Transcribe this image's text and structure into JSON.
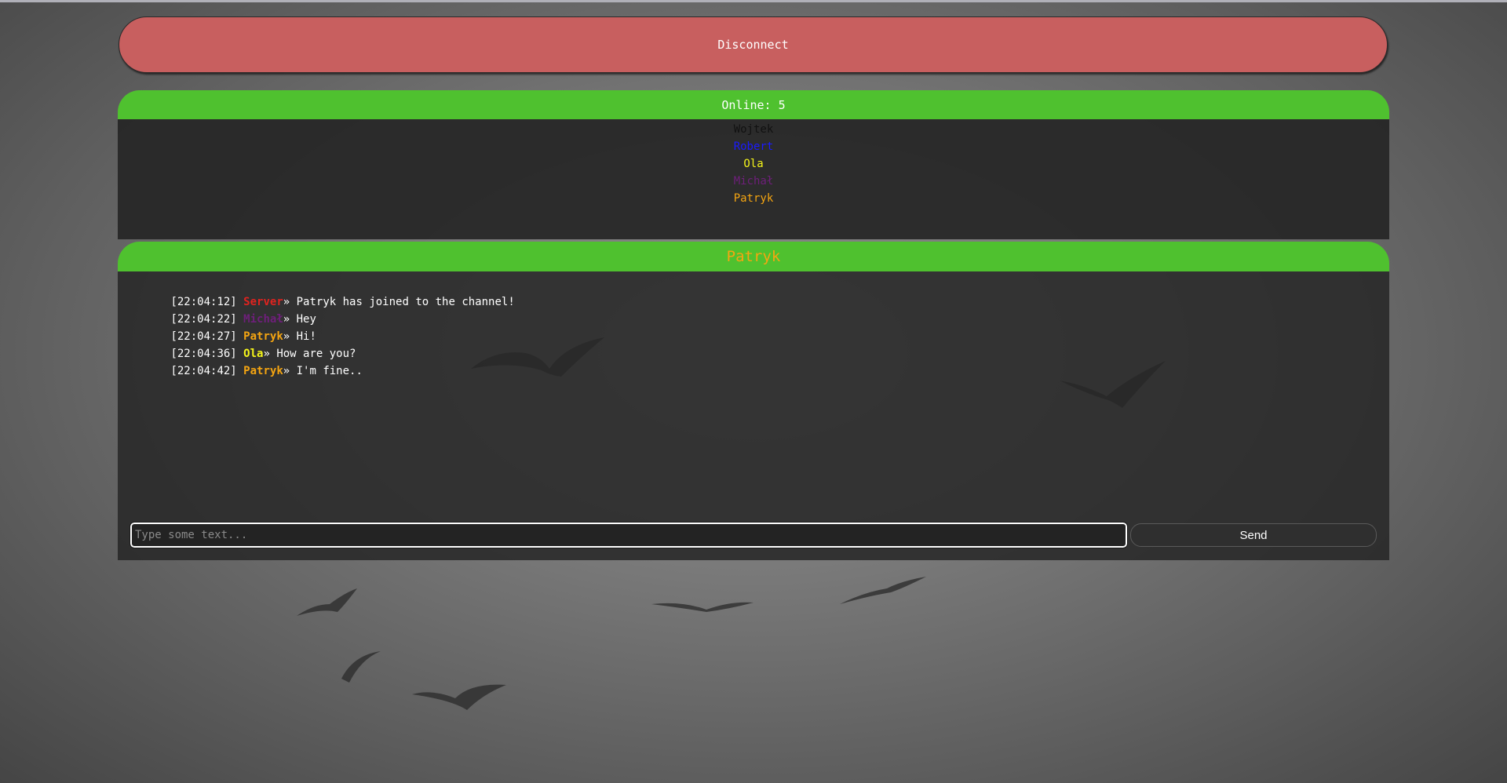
{
  "disconnect_label": "Disconnect",
  "online": {
    "label": "Online: 5",
    "users": [
      {
        "name": "Wojtek",
        "color": "#111111"
      },
      {
        "name": "Robert",
        "color": "#1a1aff"
      },
      {
        "name": "Ola",
        "color": "#f5f51a"
      },
      {
        "name": "Michał",
        "color": "#6e1f7a"
      },
      {
        "name": "Patryk",
        "color": "#f5a511"
      }
    ]
  },
  "chat": {
    "current_user": "Patryk",
    "messages": [
      {
        "time": "[22:04:12]",
        "author": "Server",
        "author_color": "#e0231f",
        "text": "Patryk has joined to the channel!"
      },
      {
        "time": "[22:04:22]",
        "author": "Michał",
        "author_color": "#6e1f7a",
        "text": "Hey"
      },
      {
        "time": "[22:04:27]",
        "author": "Patryk",
        "author_color": "#f5a511",
        "text": "Hi!"
      },
      {
        "time": "[22:04:36]",
        "author": "Ola",
        "author_color": "#f5f51a",
        "text": "How are you?"
      },
      {
        "time": "[22:04:42]",
        "author": "Patryk",
        "author_color": "#f5a511",
        "text": "I'm fine.."
      }
    ],
    "separator": "» ",
    "input_placeholder": "Type some text...",
    "input_value": "",
    "send_label": "Send"
  },
  "colors": {
    "header_green": "#4fc12f",
    "disconnect_red": "#c85f5f",
    "panel_dark": "#262626"
  },
  "background_icon": "birds-in-sky"
}
